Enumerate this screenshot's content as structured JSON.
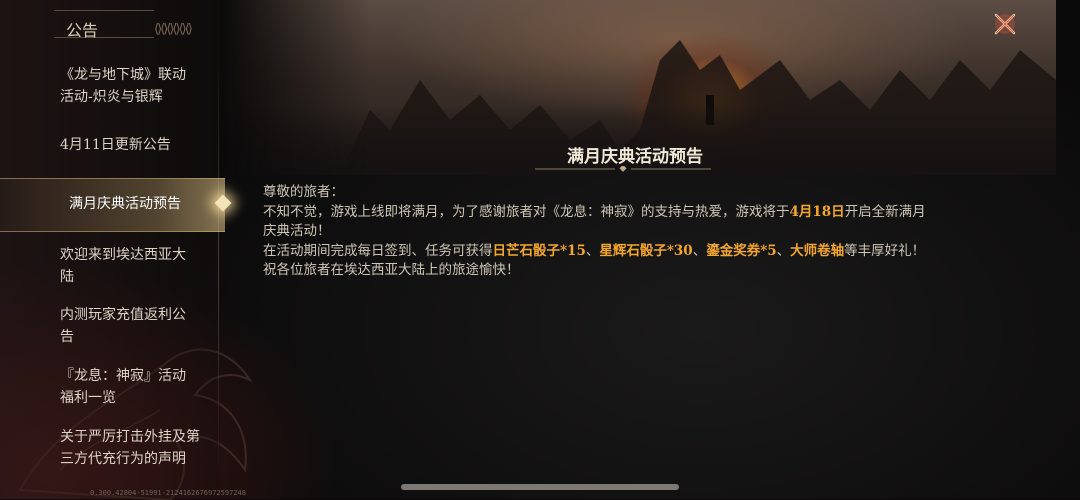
{
  "header": {
    "title": "公告"
  },
  "nav": {
    "items": [
      {
        "line1": "《龙与地下城》联动",
        "line2": "活动-炽炎与银辉"
      },
      {
        "line1": "4月11日更新公告",
        "line2": ""
      },
      {
        "line1": "满月庆典活动预告",
        "line2": ""
      },
      {
        "line1": "欢迎来到埃达西亚大",
        "line2": "陆"
      },
      {
        "line1": "内测玩家充值返利公",
        "line2": "告"
      },
      {
        "line1": "『龙息：神寂』活动",
        "line2": "福利一览"
      },
      {
        "line1": "关于严厉打击外挂及第",
        "line2": "三方代充行为的声明"
      }
    ],
    "active_index": 2
  },
  "article": {
    "title": "满月庆典活动预告",
    "greeting": "尊敬的旅者：",
    "p1_a": "不知不觉，游戏上线即将满月，为了感谢旅者对《龙息：神寂》的支持与热爱，游戏将于",
    "p1_date": "4月18日",
    "p1_b": "开启全新满月",
    "p1_c": "庆典活动！",
    "p2_a": "在活动期间完成每日签到、任务可获得",
    "reward1": "日芒石骰子*15",
    "sep1": "、",
    "reward2": "星辉石骰子*30",
    "sep2": "、",
    "reward3": "鎏金奖券*5",
    "sep3": "、",
    "reward4": "大师卷轴",
    "p2_b": "等丰厚好礼！",
    "p3": "祝各位旅者在埃达西亚大陆上的旅途愉快！"
  },
  "footer": {
    "version": "0.300.42804-51991-2124162676972597248"
  },
  "colors": {
    "highlight": "#f4a72a",
    "background": "#0c0a0a",
    "text": "#cfc6b6"
  },
  "icons": {
    "close": "close-x-icon",
    "active_marker": "diamond-icon"
  }
}
